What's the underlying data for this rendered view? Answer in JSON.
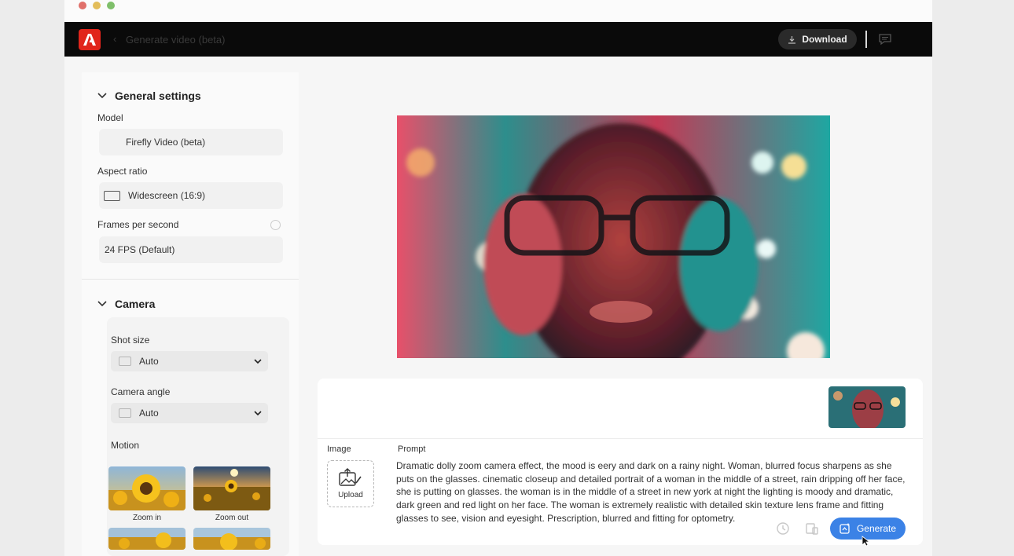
{
  "app": {
    "page_title": "Generate video (beta)",
    "download_label": "Download",
    "accent_color": "#3b82e6",
    "brand_color": "#e1251b"
  },
  "sidebar": {
    "general": {
      "title": "General settings",
      "model_label": "Model",
      "model_value": "Firefly Video (beta)",
      "aspect_label": "Aspect ratio",
      "aspect_value": "Widescreen (16:9)",
      "fps_label": "Frames per second",
      "fps_value": "24 FPS (Default)"
    },
    "camera": {
      "title": "Camera",
      "shot_size_label": "Shot size",
      "shot_size_value": "Auto",
      "angle_label": "Camera angle",
      "angle_value": "Auto",
      "motion_label": "Motion",
      "motion_options": [
        "Zoom in",
        "Zoom out"
      ]
    }
  },
  "prompt_panel": {
    "image_label": "Image",
    "upload_label": "Upload",
    "prompt_label": "Prompt",
    "prompt_text": "Dramatic dolly zoom camera effect, the mood is eery and dark on a rainy night. Woman, blurred focus sharpens as she puts on the glasses. cinematic closeup and detailed portrait of a woman in the middle of a street, rain dripping off her face, she is putting on glasses. the woman is in the middle of a street in new york at night the lighting is moody and dramatic, dark green and red light on her face. The woman is extremely realistic with detailed skin texture lens frame and fitting glasses to see, vision and eyesight. Prescription, blurred and fitting for optometry.",
    "generate_label": "Generate"
  }
}
